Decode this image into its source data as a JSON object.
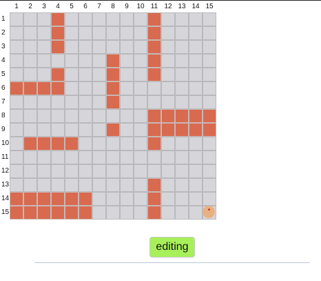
{
  "columns": [
    "1",
    "2",
    "3",
    "4",
    "5",
    "6",
    "7",
    "8",
    "9",
    "10",
    "11",
    "12",
    "13",
    "14",
    "15"
  ],
  "rows": [
    "1",
    "2",
    "3",
    "4",
    "5",
    "6",
    "7",
    "8",
    "9",
    "10",
    "11",
    "12",
    "13",
    "14",
    "15"
  ],
  "board": [
    "...#......#....",
    "...#......#....",
    "...#......#....",
    ".......#..#....",
    "...#...#..#....",
    "####...#.......",
    ".......#.......",
    "..........#####",
    ".......#..#####",
    ".####.....#....",
    "...............",
    "...............",
    "..........#....",
    "######....#....",
    "######....#...."
  ],
  "player": {
    "row": 15,
    "col": 15
  },
  "colors": {
    "wall": "#d86a50",
    "empty": "#d6d6da",
    "player": "#e7b283",
    "player_dot": "#d03b2f",
    "button": "#a8f05a"
  },
  "mode_button": {
    "label": "editing"
  }
}
